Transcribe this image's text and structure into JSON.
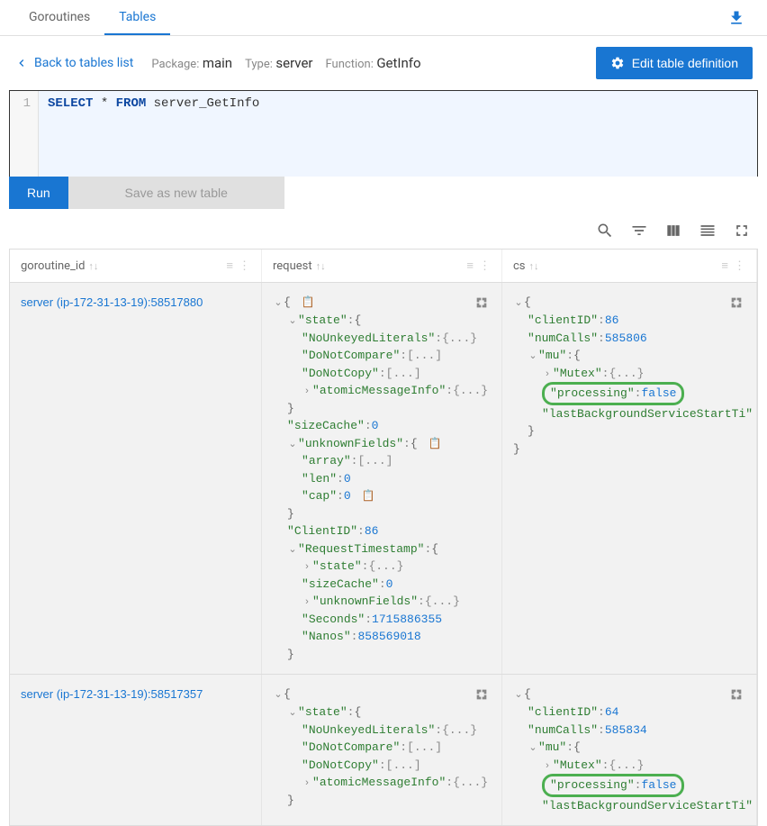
{
  "tabs": {
    "goroutines": "Goroutines",
    "tables": "Tables"
  },
  "back_link": "Back to tables list",
  "meta": {
    "package_label": "Package:",
    "package": "main",
    "type_label": "Type:",
    "type": "server",
    "function_label": "Function:",
    "function": "GetInfo"
  },
  "edit_button": "Edit table definition",
  "sql": {
    "kw_select": "SELECT",
    "star": "*",
    "kw_from": "FROM",
    "table": "server_GetInfo"
  },
  "run": "Run",
  "save": "Save as new table",
  "columns": {
    "c1": "goroutine_id",
    "c2": "request",
    "c3": "cs"
  },
  "rows": [
    {
      "gid": "server (ip-172-31-13-19):58517880",
      "request": {
        "state": {
          "NoUnkeyedLiterals": "{...}",
          "DoNotCompare": "[...]",
          "DoNotCopy": "[...]",
          "atomicMessageInfo": "{...}"
        },
        "sizeCache": 0,
        "unknownFields": {
          "array": "[...]",
          "len": 0,
          "cap": 0
        },
        "ClientID": 86,
        "RequestTimestamp": {
          "state": "{...}",
          "sizeCache": 0,
          "unknownFields": "{...}",
          "Seconds": 1715886355,
          "Nanos": 858569018
        }
      },
      "cs": {
        "clientID": 86,
        "numCalls": 585806,
        "mu": {
          "Mutex": "{...}",
          "processing": false,
          "lastBackgroundServiceStartTi": ""
        }
      }
    },
    {
      "gid": "server (ip-172-31-13-19):58517357",
      "request": {
        "state": {
          "NoUnkeyedLiterals": "{...}",
          "DoNotCompare": "[...]",
          "DoNotCopy": "[...]",
          "atomicMessageInfo": "{...}"
        }
      },
      "cs": {
        "clientID": 64,
        "numCalls": 585834,
        "mu": {
          "Mutex": "{...}",
          "processing": false,
          "lastBackgroundServiceStartTi": ""
        }
      }
    }
  ]
}
